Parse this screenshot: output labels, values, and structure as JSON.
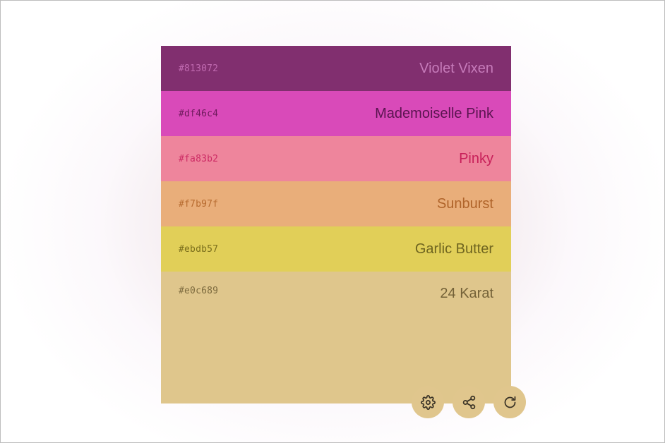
{
  "palette": {
    "swatches": [
      {
        "hex": "#813072",
        "name": "Violet Vixen",
        "bg": "#812f6f",
        "hex_color": "#c06ab0",
        "name_color": "#c67bba"
      },
      {
        "hex": "#df46c4",
        "name": "Mademoiselle Pink",
        "bg": "#d94ab9",
        "hex_color": "#6e1a5c",
        "name_color": "#5a1450"
      },
      {
        "hex": "#fa83b2",
        "name": "Pinky",
        "bg": "#ee859c",
        "hex_color": "#cc2a64",
        "name_color": "#c8205a"
      },
      {
        "hex": "#f7b97f",
        "name": "Sunburst",
        "bg": "#e9ae7a",
        "hex_color": "#b66a2e",
        "name_color": "#b0642a"
      },
      {
        "hex": "#ebdb57",
        "name": "Garlic Butter",
        "bg": "#e1cf58",
        "hex_color": "#7a6e1c",
        "name_color": "#6f6520"
      },
      {
        "hex": "#e0c689",
        "name": "24 Karat",
        "bg": "#dfc68c",
        "hex_color": "#7c6a3e",
        "name_color": "#746238"
      }
    ]
  },
  "actions": {
    "bg": "#e0c68d",
    "buttons": [
      {
        "icon": "gear-icon",
        "label": "settings"
      },
      {
        "icon": "share-icon",
        "label": "share"
      },
      {
        "icon": "refresh-icon",
        "label": "refresh"
      }
    ]
  }
}
